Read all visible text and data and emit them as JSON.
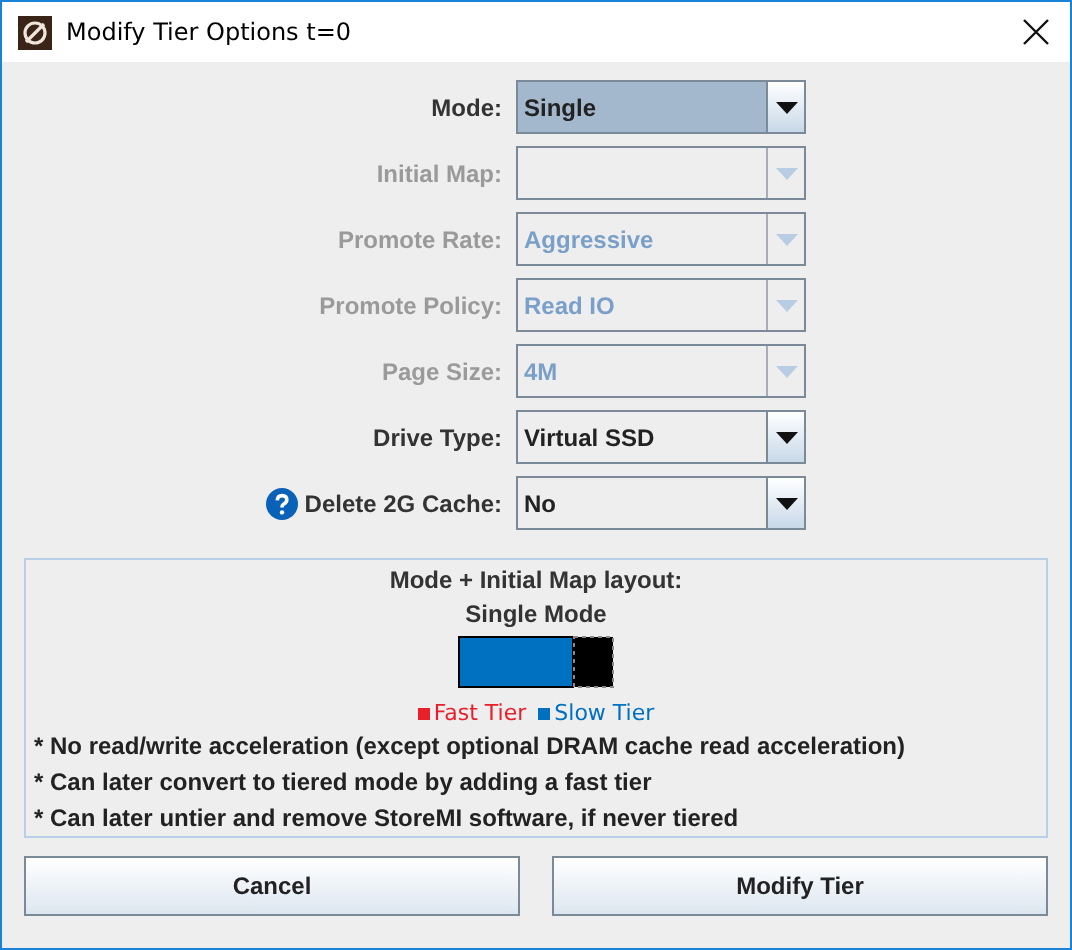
{
  "window": {
    "title": "Modify Tier Options t=0"
  },
  "fields": [
    {
      "label": "Mode:",
      "value": "Single",
      "disabled": false,
      "focused": true,
      "help": false
    },
    {
      "label": "Initial Map:",
      "disabled": true,
      "focused": false,
      "help": false
    },
    {
      "label": "Promote Rate:",
      "value": "Aggressive",
      "disabled": true,
      "focused": false,
      "help": false
    },
    {
      "label": "Promote Policy:",
      "value": "Read IO",
      "disabled": true,
      "focused": false,
      "help": false
    },
    {
      "label": "Page Size:",
      "value": "4M",
      "disabled": true,
      "focused": false,
      "help": false
    },
    {
      "label": "Drive Type:",
      "value": "Virtual SSD",
      "disabled": false,
      "focused": false,
      "help": false
    },
    {
      "label": "Delete 2G Cache:",
      "value": "No",
      "disabled": false,
      "focused": false,
      "help": true
    }
  ],
  "layout_panel": {
    "title": "Mode + Initial Map layout:",
    "subtitle": "Single Mode",
    "legend": [
      {
        "label": "Fast Tier",
        "color": "#e8202a"
      },
      {
        "label": "Slow Tier",
        "color": "#0070c0"
      }
    ],
    "notes": [
      "* No read/write acceleration (except optional DRAM cache read acceleration)",
      "* Can later convert to tiered mode by adding a fast tier",
      "* Can later untier and remove StoreMI software, if never tiered"
    ]
  },
  "buttons": [
    "Cancel",
    "Modify Tier"
  ]
}
